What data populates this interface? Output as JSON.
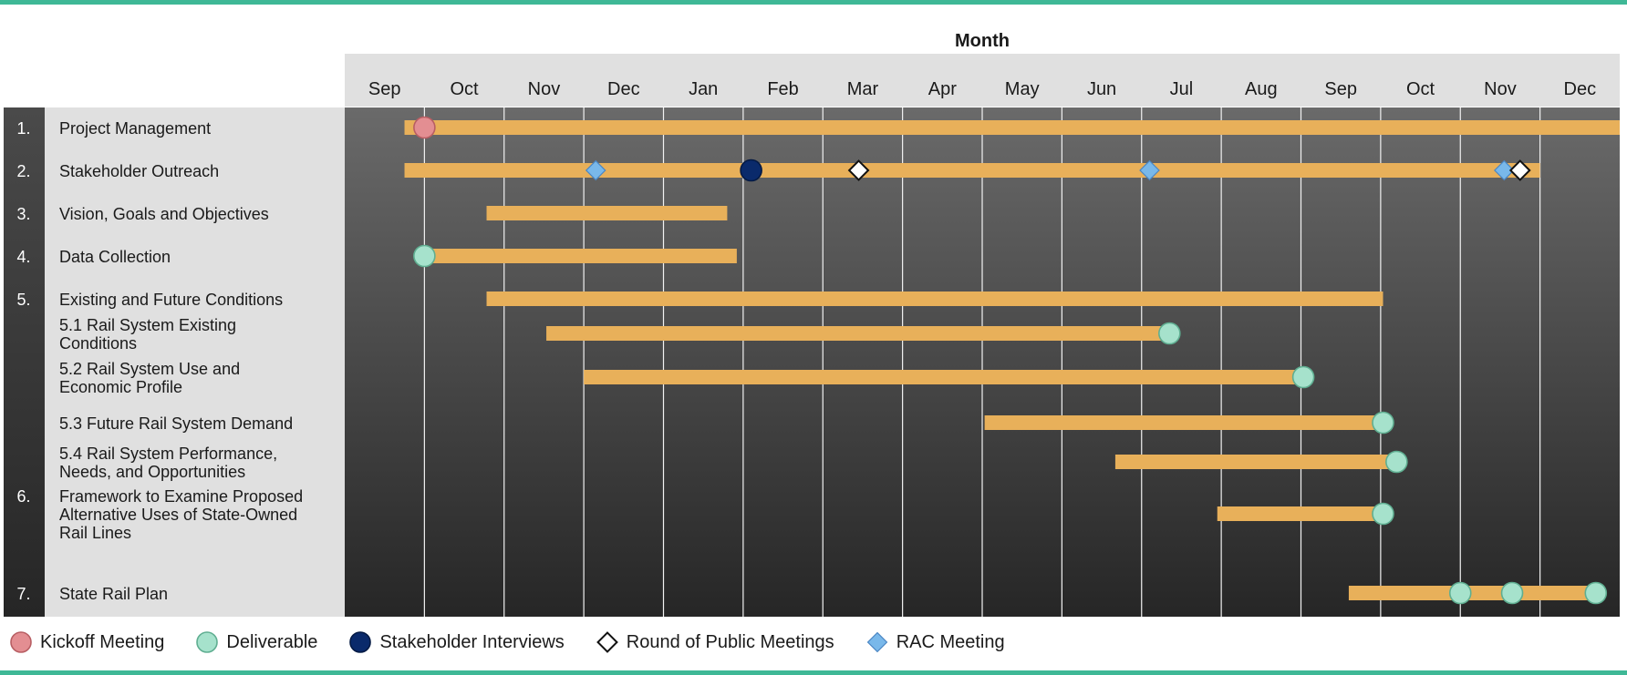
{
  "chart_data": {
    "type": "gantt",
    "title": "Month",
    "months": [
      "Sep",
      "Oct",
      "Nov",
      "Dec",
      "Jan",
      "Feb",
      "Mar",
      "Apr",
      "May",
      "Jun",
      "Jul",
      "Aug",
      "Sep",
      "Oct",
      "Nov",
      "Dec"
    ],
    "tasks": [
      {
        "num": "1.",
        "label": "Project Management",
        "lines": [
          "Project Management"
        ],
        "start": 0.75,
        "end": 16.0,
        "milestones": [
          {
            "type": "kickoff",
            "at": 1.0
          }
        ]
      },
      {
        "num": "2.",
        "label": "Stakeholder Outreach",
        "lines": [
          "Stakeholder Outreach"
        ],
        "start": 0.75,
        "end": 15.0,
        "milestones": [
          {
            "type": "rac",
            "at": 3.15
          },
          {
            "type": "interview",
            "at": 5.1
          },
          {
            "type": "public",
            "at": 6.45
          },
          {
            "type": "rac",
            "at": 10.1
          },
          {
            "type": "rac",
            "at": 14.55
          },
          {
            "type": "public",
            "at": 14.75
          }
        ]
      },
      {
        "num": "3.",
        "label": "Vision, Goals and Objectives",
        "lines": [
          "Vision, Goals and Objectives"
        ],
        "start": 1.78,
        "end": 4.8,
        "milestones": []
      },
      {
        "num": "4.",
        "label": "Data Collection",
        "lines": [
          "Data Collection"
        ],
        "start": 1.0,
        "end": 4.92,
        "milestones": [
          {
            "type": "deliverable",
            "at": 1.0
          }
        ]
      },
      {
        "num": "5.",
        "label": "Existing and Future Conditions",
        "lines": [
          "Existing and Future Conditions"
        ],
        "start": 1.78,
        "end": 13.03,
        "milestones": []
      },
      {
        "num": "",
        "label": "5.1 Rail System Existing Conditions",
        "lines": [
          "5.1 Rail System Existing",
          "Conditions"
        ],
        "start": 2.53,
        "end": 10.35,
        "milestones": [
          {
            "type": "deliverable",
            "at": 10.35
          }
        ]
      },
      {
        "num": "",
        "label": "5.2 Rail System Use and Economic Profile",
        "lines": [
          "5.2 Rail System Use and",
          "Economic Profile"
        ],
        "start": 3.0,
        "end": 12.03,
        "milestones": [
          {
            "type": "deliverable",
            "at": 12.03
          }
        ]
      },
      {
        "num": "",
        "label": "5.3 Future Rail System Demand",
        "lines": [
          "5.3 Future Rail System Demand"
        ],
        "start": 8.03,
        "end": 13.03,
        "milestones": [
          {
            "type": "deliverable",
            "at": 13.03
          }
        ]
      },
      {
        "num": "",
        "label": "5.4 Rail System Performance, Needs, and Opportunities",
        "lines": [
          "5.4 Rail System Performance,",
          "Needs, and Opportunities"
        ],
        "start": 9.67,
        "end": 13.2,
        "milestones": [
          {
            "type": "deliverable",
            "at": 13.2
          }
        ]
      },
      {
        "num": "6.",
        "label": "Framework to Examine Proposed Alternative Uses of State-Owned Rail Lines",
        "lines": [
          "Framework to Examine Proposed",
          "Alternative Uses of State-Owned",
          "Rail Lines"
        ],
        "start": 10.95,
        "end": 13.03,
        "milestones": [
          {
            "type": "deliverable",
            "at": 13.03
          }
        ]
      },
      {
        "num": "7.",
        "label": "State Rail Plan",
        "lines": [
          "State Rail Plan"
        ],
        "start": 12.6,
        "end": 15.7,
        "milestones": [
          {
            "type": "deliverable",
            "at": 14.0
          },
          {
            "type": "deliverable",
            "at": 14.65
          },
          {
            "type": "deliverable",
            "at": 15.7
          }
        ]
      }
    ],
    "legend": [
      {
        "type": "kickoff",
        "label": "Kickoff Meeting"
      },
      {
        "type": "deliverable",
        "label": "Deliverable"
      },
      {
        "type": "interview",
        "label": "Stakeholder Interviews"
      },
      {
        "type": "public",
        "label": "Round of Public Meetings"
      },
      {
        "type": "rac",
        "label": "RAC Meeting"
      }
    ],
    "colors": {
      "bar": "#e8b05a",
      "kickoff": "#e38e92",
      "deliverable": "#a6e2cc",
      "interview": "#0a2a6b",
      "public": "#ffffff",
      "rac": "#79b8ea",
      "accent_rule": "#3fb896",
      "header_bg": "#e0e0e0",
      "number_col_bg": "#383838"
    }
  }
}
